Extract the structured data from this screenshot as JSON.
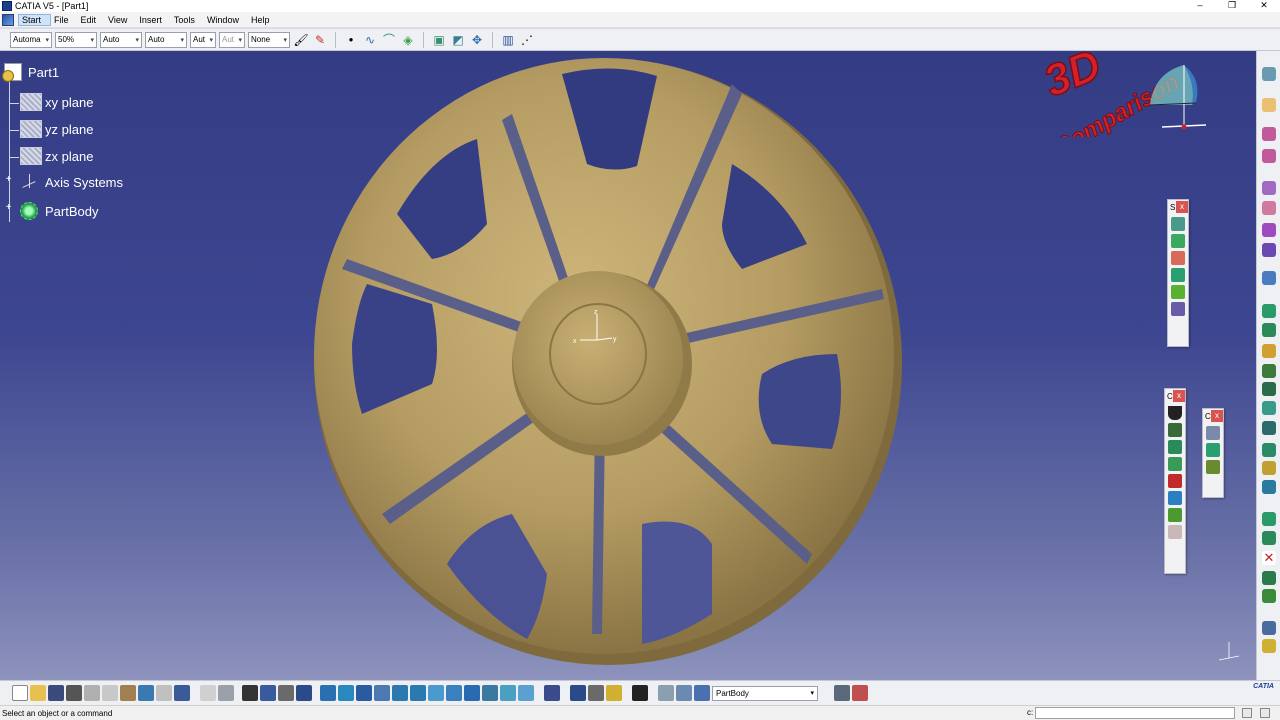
{
  "window": {
    "title": "CATIA V5 - [Part1]",
    "controls": [
      "–",
      "❐",
      "✕"
    ]
  },
  "menu": [
    "Start",
    "File",
    "Edit",
    "View",
    "Insert",
    "Tools",
    "Window",
    "Help"
  ],
  "toolbar_top": {
    "combos": [
      {
        "value": "Automa",
        "disabled": false
      },
      {
        "value": "50%",
        "disabled": false
      },
      {
        "value": "Auto",
        "disabled": false
      },
      {
        "value": "Auto",
        "disabled": false
      },
      {
        "value": "Aut",
        "disabled": false
      },
      {
        "value": "Aut",
        "disabled": true
      },
      {
        "value": "None",
        "disabled": false
      }
    ]
  },
  "tree": {
    "root": "Part1",
    "items": [
      "xy plane",
      "yz plane",
      "zx plane",
      "Axis Systems",
      "PartBody"
    ]
  },
  "watermark": {
    "line1": "3D",
    "line2": "Comparison"
  },
  "axis_labels": {
    "x": "x",
    "y": "y",
    "z": "z"
  },
  "floating_toolbars": [
    {
      "title": "S",
      "close": "x"
    },
    {
      "title": "C",
      "close": "x"
    },
    {
      "title": "C",
      "close": "x"
    }
  ],
  "bottom_toolbar": {
    "body_select": "PartBody"
  },
  "branding": "CATIA",
  "status": {
    "message": "Select an object or a command",
    "cmd_prefix": "c:"
  },
  "colors": {
    "viewport_top": "#343c84",
    "part": "#bba36a",
    "watermark_red": "#d4202a"
  }
}
